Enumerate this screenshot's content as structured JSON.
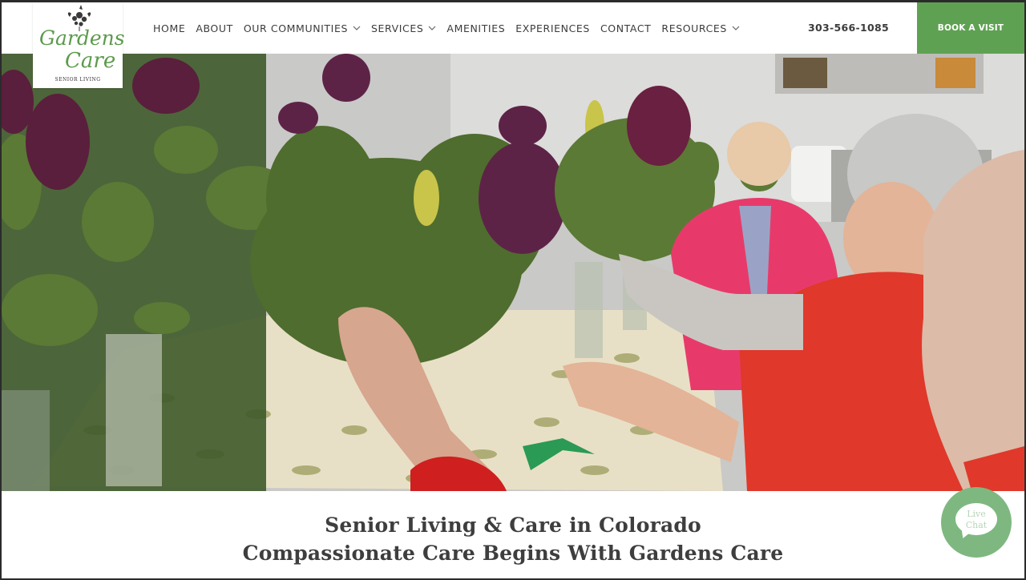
{
  "brand": {
    "name_line1": "Gardens",
    "name_line2": "Care",
    "tagline": "SENIOR LIVING",
    "accent_color": "#5fa152"
  },
  "nav": {
    "items": [
      {
        "label": "HOME",
        "dropdown": false
      },
      {
        "label": "ABOUT",
        "dropdown": false
      },
      {
        "label": "OUR COMMUNITIES",
        "dropdown": true
      },
      {
        "label": "SERVICES",
        "dropdown": true
      },
      {
        "label": "AMENITIES",
        "dropdown": false
      },
      {
        "label": "EXPERIENCES",
        "dropdown": false
      },
      {
        "label": "CONTACT",
        "dropdown": false
      },
      {
        "label": "RESOURCES",
        "dropdown": true
      }
    ],
    "phone": "303-566-1085",
    "book_label": "BOOK A VISIT"
  },
  "hero": {
    "image_icon": "photo-icon"
  },
  "headline": {
    "line1": "Senior Living & Care in Colorado",
    "line2": "Compassionate Care Begins With Gardens Care"
  },
  "chat": {
    "line1": "Live",
    "line2": "Chat",
    "icon": "chat-bubble-icon",
    "color": "#7eb880"
  }
}
